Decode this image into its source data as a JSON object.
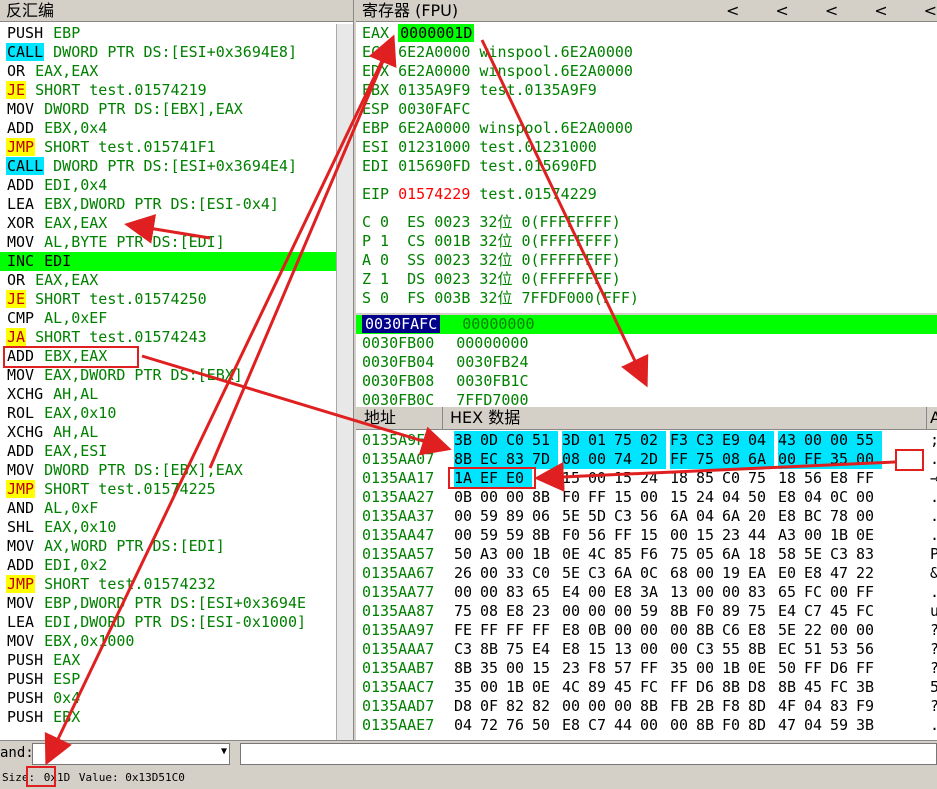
{
  "disasm": {
    "title": "反汇编",
    "lines": [
      {
        "m": "PUSH",
        "o": "EBP",
        "k": "plain"
      },
      {
        "m": "CALL",
        "o": "DWORD PTR DS:[ESI+0x3694E8]",
        "k": "call"
      },
      {
        "m": "OR",
        "o": "EAX,EAX",
        "k": "plain"
      },
      {
        "m": "JE",
        "o": "SHORT test.01574219",
        "k": "jcc"
      },
      {
        "m": "MOV",
        "o": "DWORD PTR DS:[EBX],EAX",
        "k": "plain"
      },
      {
        "m": "ADD",
        "o": "EBX,0x4",
        "k": "plain"
      },
      {
        "m": "JMP",
        "o": "SHORT test.015741F1",
        "k": "jmp"
      },
      {
        "m": "CALL",
        "o": "DWORD PTR DS:[ESI+0x3694E4]",
        "k": "call"
      },
      {
        "m": "ADD",
        "o": "EDI,0x4",
        "k": "plain"
      },
      {
        "m": "LEA",
        "o": "EBX,DWORD PTR DS:[ESI-0x4]",
        "k": "plain"
      },
      {
        "m": "XOR",
        "o": "EAX,EAX",
        "k": "plain"
      },
      {
        "m": "MOV",
        "o": "AL,BYTE PTR DS:[EDI]",
        "k": "plain"
      },
      {
        "m": "INC",
        "o": "EDI",
        "k": "current"
      },
      {
        "m": "OR",
        "o": "EAX,EAX",
        "k": "plain"
      },
      {
        "m": "JE",
        "o": "SHORT test.01574250",
        "k": "jcc"
      },
      {
        "m": "CMP",
        "o": "AL,0xEF",
        "k": "plain"
      },
      {
        "m": "JA",
        "o": "SHORT test.01574243",
        "k": "jcc"
      },
      {
        "m": "ADD",
        "o": "EBX,EAX",
        "k": "plain"
      },
      {
        "m": "MOV",
        "o": "EAX,DWORD PTR DS:[EBX]",
        "k": "plain"
      },
      {
        "m": "XCHG",
        "o": "AH,AL",
        "k": "plain"
      },
      {
        "m": "ROL",
        "o": "EAX,0x10",
        "k": "plain"
      },
      {
        "m": "XCHG",
        "o": "AH,AL",
        "k": "plain"
      },
      {
        "m": "ADD",
        "o": "EAX,ESI",
        "k": "plain"
      },
      {
        "m": "MOV",
        "o": "DWORD PTR DS:[EBX],EAX",
        "k": "plain"
      },
      {
        "m": "JMP",
        "o": "SHORT test.01574225",
        "k": "jmp"
      },
      {
        "m": "AND",
        "o": "AL,0xF",
        "k": "plain"
      },
      {
        "m": "SHL",
        "o": "EAX,0x10",
        "k": "plain"
      },
      {
        "m": "MOV",
        "o": "AX,WORD PTR DS:[EDI]",
        "k": "plain"
      },
      {
        "m": "ADD",
        "o": "EDI,0x2",
        "k": "plain"
      },
      {
        "m": "JMP",
        "o": "SHORT test.01574232",
        "k": "jmp"
      },
      {
        "m": "MOV",
        "o": "EBP,DWORD PTR DS:[ESI+0x3694E",
        "k": "plain"
      },
      {
        "m": "LEA",
        "o": "EDI,DWORD PTR DS:[ESI-0x1000]",
        "k": "plain"
      },
      {
        "m": "MOV",
        "o": "EBX,0x1000",
        "k": "plain"
      },
      {
        "m": "PUSH",
        "o": "EAX",
        "k": "plain"
      },
      {
        "m": "PUSH",
        "o": "ESP",
        "k": "plain"
      },
      {
        "m": "PUSH",
        "o": "0x4",
        "k": "plain"
      },
      {
        "m": "PUSH",
        "o": "EBX",
        "k": "plain"
      }
    ]
  },
  "registers": {
    "title": "寄存器 (FPU)",
    "nav": [
      "<",
      "<",
      "<",
      "<",
      "<"
    ],
    "general": [
      {
        "name": "EAX",
        "value": "0000001D",
        "comment": ""
      },
      {
        "name": "ECX",
        "value": "6E2A0000",
        "comment": "winspool.6E2A0000"
      },
      {
        "name": "EDX",
        "value": "6E2A0000",
        "comment": "winspool.6E2A0000"
      },
      {
        "name": "EBX",
        "value": "0135A9F9",
        "comment": "test.0135A9F9"
      },
      {
        "name": "ESP",
        "value": "0030FAFC",
        "comment": ""
      },
      {
        "name": "EBP",
        "value": "6E2A0000",
        "comment": "winspool.6E2A0000"
      },
      {
        "name": "ESI",
        "value": "01231000",
        "comment": "test.01231000"
      },
      {
        "name": "EDI",
        "value": "015690FD",
        "comment": "test.015690FD"
      }
    ],
    "eip": {
      "name": "EIP",
      "value": "01574229",
      "comment": "test.01574229"
    },
    "flags": [
      "C 0  ES 0023 32位 0(FFFFFFFF)",
      "P 1  CS 001B 32位 0(FFFFFFFF)",
      "A 0  SS 0023 32位 0(FFFFFFFF)",
      "Z 1  DS 0023 32位 0(FFFFFFFF)",
      "S 0  FS 003B 32位 7FFDF000(FFF)"
    ]
  },
  "stack": {
    "rows": [
      {
        "addr": "0030FAFC",
        "val": "00000000"
      },
      {
        "addr": "0030FB00",
        "val": "00000000"
      },
      {
        "addr": "0030FB04",
        "val": "0030FB24"
      },
      {
        "addr": "0030FB08",
        "val": "0030FB1C"
      },
      {
        "addr": "0030FB0C",
        "val": "7FFD7000"
      }
    ]
  },
  "hexdump": {
    "col_addr": "地址",
    "col_hex": "HEX 数据",
    "col_ascii": "A",
    "rows": [
      {
        "addr": "0135A9F7",
        "bytes": [
          "3B",
          "0D",
          "C0",
          "51",
          "3D",
          "01",
          "75",
          "02",
          "F3",
          "C3",
          "E9",
          "04",
          "43",
          "00",
          "00",
          "55"
        ],
        "ascii": ";"
      },
      {
        "addr": "0135AA07",
        "bytes": [
          "8B",
          "EC",
          "83",
          "7D",
          "08",
          "00",
          "74",
          "2D",
          "FF",
          "75",
          "08",
          "6A",
          "00",
          "FF",
          "35",
          "00"
        ],
        "ascii": "."
      },
      {
        "addr": "0135AA17",
        "bytes": [
          "1A",
          "EF",
          "E0",
          "",
          "15",
          "00",
          "15",
          "24",
          "18",
          "85",
          "C0",
          "75",
          "18",
          "56",
          "E8",
          "FF"
        ],
        "ascii": "→"
      },
      {
        "addr": "0135AA27",
        "bytes": [
          "0B",
          "00",
          "00",
          "8B",
          "F0",
          "FF",
          "15",
          "00",
          "15",
          "24",
          "04",
          "50",
          "E8",
          "04",
          "0C",
          "00"
        ],
        "ascii": "."
      },
      {
        "addr": "0135AA37",
        "bytes": [
          "00",
          "59",
          "89",
          "06",
          "5E",
          "5D",
          "C3",
          "56",
          "6A",
          "04",
          "6A",
          "20",
          "E8",
          "BC",
          "78",
          "00"
        ],
        "ascii": "."
      },
      {
        "addr": "0135AA47",
        "bytes": [
          "00",
          "59",
          "59",
          "8B",
          "F0",
          "56",
          "FF",
          "15",
          "00",
          "15",
          "23",
          "44",
          "A3",
          "00",
          "1B",
          "0E"
        ],
        "ascii": "."
      },
      {
        "addr": "0135AA57",
        "bytes": [
          "50",
          "A3",
          "00",
          "1B",
          "0E",
          "4C",
          "85",
          "F6",
          "75",
          "05",
          "6A",
          "18",
          "58",
          "5E",
          "C3",
          "83"
        ],
        "ascii": "P"
      },
      {
        "addr": "0135AA67",
        "bytes": [
          "26",
          "00",
          "33",
          "C0",
          "5E",
          "C3",
          "6A",
          "0C",
          "68",
          "00",
          "19",
          "EA",
          "E0",
          "E8",
          "47",
          "22"
        ],
        "ascii": "&"
      },
      {
        "addr": "0135AA77",
        "bytes": [
          "00",
          "00",
          "83",
          "65",
          "E4",
          "00",
          "E8",
          "3A",
          "13",
          "00",
          "00",
          "83",
          "65",
          "FC",
          "00",
          "FF"
        ],
        "ascii": "."
      },
      {
        "addr": "0135AA87",
        "bytes": [
          "75",
          "08",
          "E8",
          "23",
          "00",
          "00",
          "00",
          "59",
          "8B",
          "F0",
          "89",
          "75",
          "E4",
          "C7",
          "45",
          "FC"
        ],
        "ascii": "u"
      },
      {
        "addr": "0135AA97",
        "bytes": [
          "FE",
          "FF",
          "FF",
          "FF",
          "E8",
          "0B",
          "00",
          "00",
          "00",
          "8B",
          "C6",
          "E8",
          "5E",
          "22",
          "00",
          "00"
        ],
        "ascii": "?"
      },
      {
        "addr": "0135AAA7",
        "bytes": [
          "C3",
          "8B",
          "75",
          "E4",
          "E8",
          "15",
          "13",
          "00",
          "00",
          "C3",
          "55",
          "8B",
          "EC",
          "51",
          "53",
          "56"
        ],
        "ascii": "?"
      },
      {
        "addr": "0135AAB7",
        "bytes": [
          "8B",
          "35",
          "00",
          "15",
          "23",
          "F8",
          "57",
          "FF",
          "35",
          "00",
          "1B",
          "0E",
          "50",
          "FF",
          "D6",
          "FF"
        ],
        "ascii": "?"
      },
      {
        "addr": "0135AAC7",
        "bytes": [
          "35",
          "00",
          "1B",
          "0E",
          "4C",
          "89",
          "45",
          "FC",
          "FF",
          "D6",
          "8B",
          "D8",
          "8B",
          "45",
          "FC",
          "3B"
        ],
        "ascii": "5"
      },
      {
        "addr": "0135AAD7",
        "bytes": [
          "D8",
          "0F",
          "82",
          "82",
          "00",
          "00",
          "00",
          "8B",
          "FB",
          "2B",
          "F8",
          "8D",
          "4F",
          "04",
          "83",
          "F9"
        ],
        "ascii": "?"
      },
      {
        "addr": "0135AAE7",
        "bytes": [
          "04",
          "72",
          "76",
          "50",
          "E8",
          "C7",
          "44",
          "00",
          "00",
          "8B",
          "F0",
          "8D",
          "47",
          "04",
          "59",
          "3B"
        ],
        "ascii": "."
      }
    ]
  },
  "command": {
    "label": "and:",
    "value": ""
  },
  "status": {
    "prefix": "Size:",
    "size": "0x1D",
    "value_label": "Value:",
    "value": "0x13D51C0"
  },
  "colors": {
    "highlight": "#00ff00",
    "call": "#00e5ff",
    "jump": "#ffff00",
    "annotation": "#e02020"
  }
}
